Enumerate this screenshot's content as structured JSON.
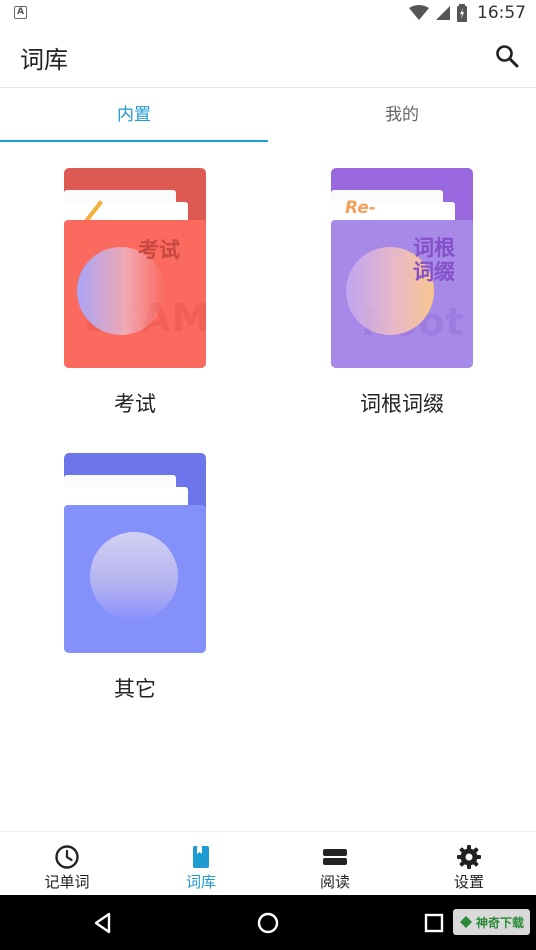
{
  "status_bar": {
    "time": "16:57"
  },
  "app_bar": {
    "title": "词库"
  },
  "tabs": [
    {
      "label": "内置",
      "active": true
    },
    {
      "label": "我的",
      "active": false
    }
  ],
  "books": [
    {
      "label": "考试",
      "cover_text": "考试",
      "cover_watermark": "EXAM",
      "color": "#f5695f"
    },
    {
      "label": "词根词缀",
      "cover_text_line1": "词根",
      "cover_text_line2": "词缀",
      "cover_tag": "Re-",
      "cover_watermark": "Root",
      "color": "#a585e6"
    },
    {
      "label": "其它",
      "color": "#8591fb"
    }
  ],
  "bottom_nav": [
    {
      "label": "记单词",
      "icon": "clock-icon",
      "active": false
    },
    {
      "label": "词库",
      "icon": "book-icon",
      "active": true
    },
    {
      "label": "阅读",
      "icon": "reading-icon",
      "active": false
    },
    {
      "label": "设置",
      "icon": "gear-icon",
      "active": false
    }
  ],
  "watermark": {
    "text": "神奇下载"
  },
  "colors": {
    "accent": "#1e9bd2"
  }
}
